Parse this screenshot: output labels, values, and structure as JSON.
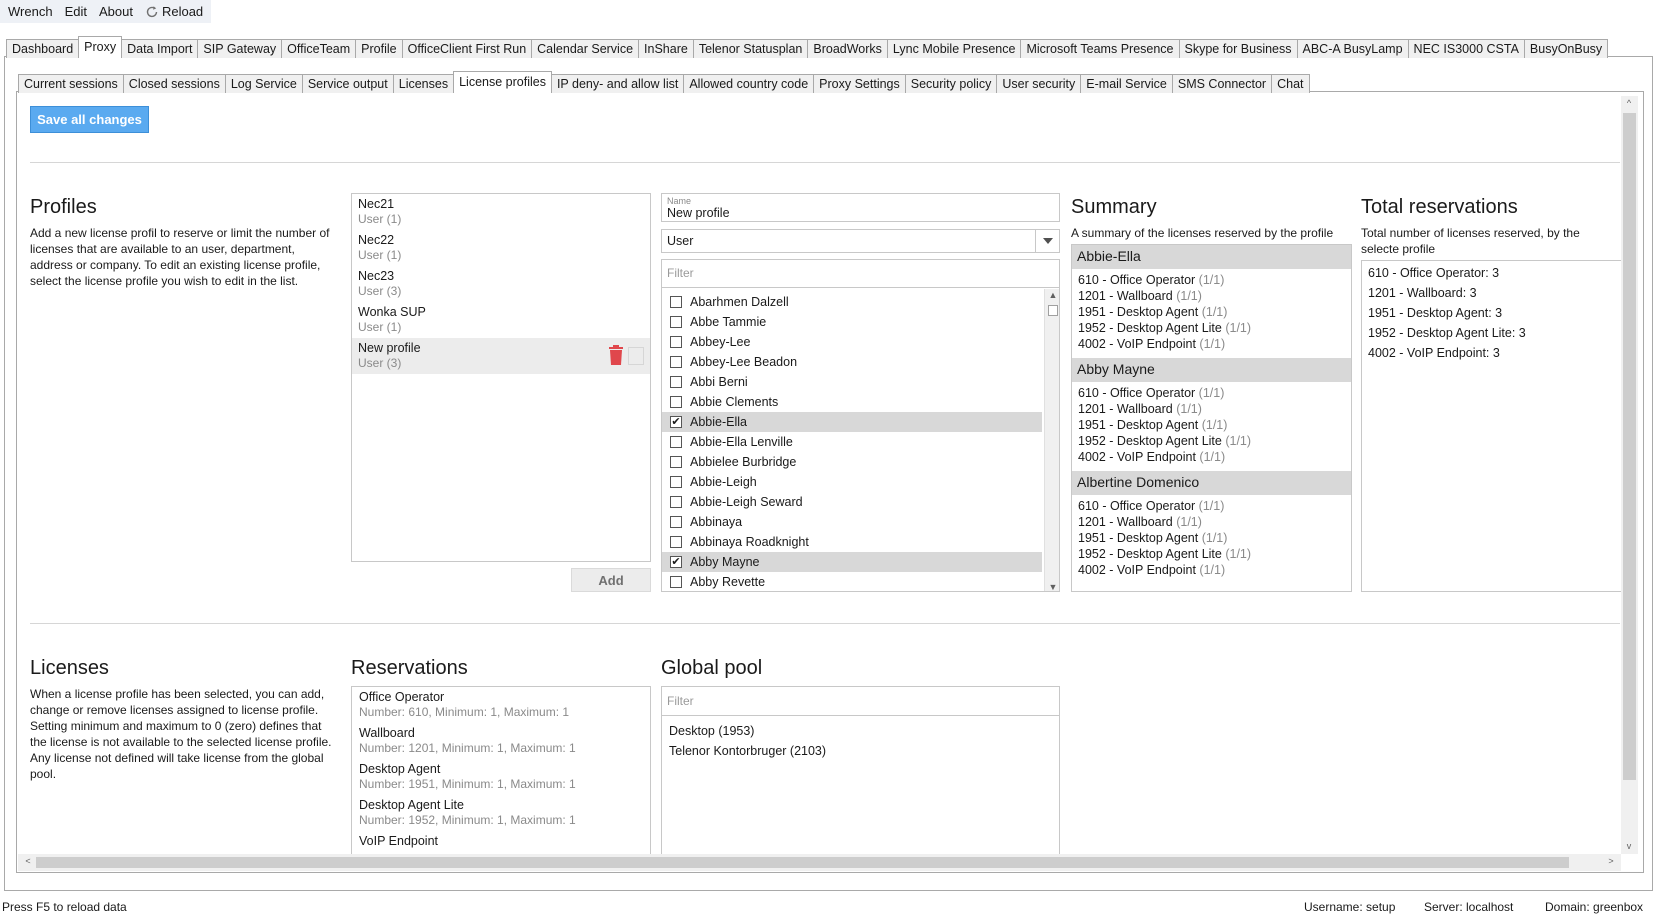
{
  "menu": {
    "items": [
      "Wrench",
      "Edit",
      "About"
    ],
    "reload": "Reload"
  },
  "top_tabs": [
    "Dashboard",
    "Proxy",
    "Data Import",
    "SIP Gateway",
    "OfficeTeam",
    "Profile",
    "OfficeClient First Run",
    "Calendar Service",
    "InShare",
    "Telenor Statusplan",
    "BroadWorks",
    "Lync Mobile Presence",
    "Microsoft Teams Presence",
    "Skype for Business",
    "ABC-A BusyLamp",
    "NEC IS3000 CSTA",
    "BusyOnBusy"
  ],
  "top_tab_active": 1,
  "sub_tabs": [
    "Current sessions",
    "Closed sessions",
    "Log Service",
    "Service output",
    "Licenses",
    "License profiles",
    "IP deny- and allow list",
    "Allowed country code",
    "Proxy Settings",
    "Security policy",
    "User security",
    "E-mail Service",
    "SMS Connector",
    "Chat"
  ],
  "sub_tab_active": 5,
  "save_button": "Save all changes",
  "profiles": {
    "title": "Profiles",
    "description": "Add a new license profil to reserve or limit the number of licenses that are available to an user, department, address or company. To edit an existing license profile, select the license profile you wish to edit in the list.",
    "items": [
      {
        "name": "Nec21",
        "sub": "User (1)"
      },
      {
        "name": "Nec22",
        "sub": "User (1)"
      },
      {
        "name": "Nec23",
        "sub": "User (3)"
      },
      {
        "name": "Wonka SUP",
        "sub": "User (1)"
      },
      {
        "name": "New profile",
        "sub": "User (3)"
      }
    ],
    "selected_index": 4,
    "add_button": "Add"
  },
  "editor": {
    "name_label": "Name",
    "name_value": "New profile",
    "type_value": "User",
    "filter_placeholder": "Filter",
    "users": [
      {
        "name": "Abarhmen Dalzell",
        "checked": false
      },
      {
        "name": "Abbe Tammie",
        "checked": false
      },
      {
        "name": "Abbey-Lee",
        "checked": false
      },
      {
        "name": "Abbey-Lee Beadon",
        "checked": false
      },
      {
        "name": "Abbi Berni",
        "checked": false
      },
      {
        "name": "Abbie Clements",
        "checked": false
      },
      {
        "name": "Abbie-Ella",
        "checked": true
      },
      {
        "name": "Abbie-Ella Lenville",
        "checked": false
      },
      {
        "name": "Abbielee Burbridge",
        "checked": false
      },
      {
        "name": "Abbie-Leigh",
        "checked": false
      },
      {
        "name": "Abbie-Leigh Seward",
        "checked": false
      },
      {
        "name": "Abbinaya",
        "checked": false
      },
      {
        "name": "Abbinaya Roadknight",
        "checked": false
      },
      {
        "name": "Abby Mayne",
        "checked": true
      },
      {
        "name": "Abby Revette",
        "checked": false
      }
    ]
  },
  "summary": {
    "title": "Summary",
    "description": "A summary of the licenses reserved by the profile",
    "groups": [
      {
        "name": "Abbie-Ella",
        "lines": [
          {
            "text": "610 - Office Operator",
            "count": "(1/1)"
          },
          {
            "text": "1201 - Wallboard",
            "count": "(1/1)"
          },
          {
            "text": "1951 - Desktop Agent",
            "count": "(1/1)"
          },
          {
            "text": "1952 - Desktop Agent Lite",
            "count": "(1/1)"
          },
          {
            "text": "4002 - VoIP Endpoint",
            "count": "(1/1)"
          }
        ]
      },
      {
        "name": "Abby Mayne",
        "lines": [
          {
            "text": "610 - Office Operator",
            "count": "(1/1)"
          },
          {
            "text": "1201 - Wallboard",
            "count": "(1/1)"
          },
          {
            "text": "1951 - Desktop Agent",
            "count": "(1/1)"
          },
          {
            "text": "1952 - Desktop Agent Lite",
            "count": "(1/1)"
          },
          {
            "text": "4002 - VoIP Endpoint",
            "count": "(1/1)"
          }
        ]
      },
      {
        "name": "Albertine Domenico",
        "lines": [
          {
            "text": "610 - Office Operator",
            "count": "(1/1)"
          },
          {
            "text": "1201 - Wallboard",
            "count": "(1/1)"
          },
          {
            "text": "1951 - Desktop Agent",
            "count": "(1/1)"
          },
          {
            "text": "1952 - Desktop Agent Lite",
            "count": "(1/1)"
          },
          {
            "text": "4002 - VoIP Endpoint",
            "count": "(1/1)"
          }
        ]
      }
    ]
  },
  "total_reservations": {
    "title": "Total reservations",
    "description": "Total number of licenses reserved, by the selecte profile",
    "lines": [
      "610 - Office Operator: 3",
      "1201 - Wallboard: 3",
      "1951 - Desktop Agent: 3",
      "1952 - Desktop Agent Lite: 3",
      "4002 - VoIP Endpoint: 3"
    ]
  },
  "licenses": {
    "title": "Licenses",
    "description": "When a license profile has been selected, you can add, change or remove licenses assigned to license profile. Setting minimum and maximum to 0 (zero) defines that the license is not available to the selected license profile. Any license not defined will take license from the global pool."
  },
  "reservations": {
    "title": "Reservations",
    "items": [
      {
        "name": "Office Operator",
        "sub": "Number: 610, Minimum: 1, Maximum: 1"
      },
      {
        "name": "Wallboard",
        "sub": "Number: 1201, Minimum: 1, Maximum: 1"
      },
      {
        "name": "Desktop Agent",
        "sub": "Number: 1951, Minimum: 1, Maximum: 1"
      },
      {
        "name": "Desktop Agent Lite",
        "sub": "Number: 1952, Minimum: 1, Maximum: 1"
      },
      {
        "name": "VoIP Endpoint",
        "sub": ""
      }
    ]
  },
  "global_pool": {
    "title": "Global pool",
    "filter_placeholder": "Filter",
    "items": [
      "Desktop (1953)",
      "Telenor Kontorbruger (2103)"
    ]
  },
  "status": {
    "hint": "Press F5 to reload data",
    "username": "Username: setup",
    "server": "Server: localhost",
    "domain": "Domain: greenbox"
  },
  "colors": {
    "accent": "#5aaaf0",
    "delete": "#e0474c"
  }
}
